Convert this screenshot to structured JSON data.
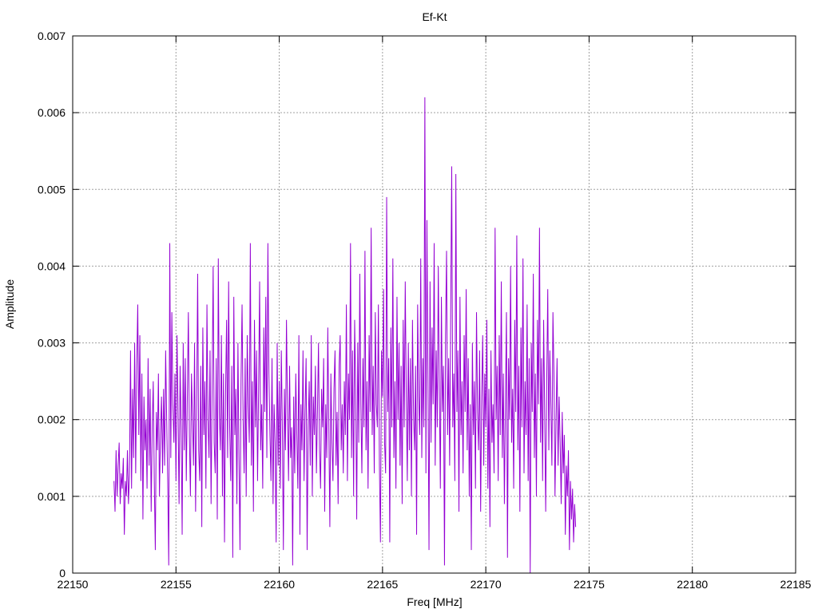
{
  "chart_data": {
    "type": "line",
    "title": "Ef-Kt",
    "xlabel": "Freq [MHz]",
    "ylabel": "Amplitude",
    "xlim": [
      22150,
      22185
    ],
    "ylim": [
      0,
      0.007
    ],
    "xticks": [
      22150,
      22155,
      22160,
      22165,
      22170,
      22175,
      22180,
      22185
    ],
    "xtick_labels": [
      "22150",
      "22155",
      "22160",
      "22165",
      "22170",
      "22175",
      "22180",
      "22185"
    ],
    "yticks": [
      0,
      0.001,
      0.002,
      0.003,
      0.004,
      0.005,
      0.006,
      0.007
    ],
    "ytick_labels": [
      "0",
      "0.001",
      "0.002",
      "0.003",
      "0.004",
      "0.005",
      "0.006",
      "0.007"
    ],
    "grid": true,
    "legend": "none",
    "series": [
      {
        "color": "#9400d3",
        "x_start": 22152.0,
        "x_step": 0.05,
        "values": [
          0.0012,
          0.0008,
          0.0016,
          0.001,
          0.0014,
          0.0017,
          0.0009,
          0.0013,
          0.0011,
          0.0015,
          0.0005,
          0.0012,
          0.001,
          0.0016,
          0.0009,
          0.0013,
          0.0029,
          0.0011,
          0.0024,
          0.0015,
          0.003,
          0.0013,
          0.0027,
          0.0035,
          0.0018,
          0.0031,
          0.0012,
          0.0026,
          0.0007,
          0.0023,
          0.0016,
          0.002,
          0.0011,
          0.0028,
          0.0014,
          0.0024,
          0.0008,
          0.0019,
          0.0025,
          0.0012,
          0.0003,
          0.0021,
          0.0016,
          0.0026,
          0.001,
          0.0018,
          0.0023,
          0.0013,
          0.0024,
          0.0014,
          0.0029,
          0.002,
          0.0012,
          0.0001,
          0.0043,
          0.0015,
          0.0034,
          0.0022,
          0.0017,
          0.0026,
          0.0012,
          0.0031,
          0.0021,
          0.0009,
          0.0027,
          0.0019,
          0.0005,
          0.003,
          0.0016,
          0.0028,
          0.0012,
          0.0023,
          0.0034,
          0.0018,
          0.001,
          0.0026,
          0.002,
          0.0014,
          0.003,
          0.0008,
          0.0021,
          0.0039,
          0.0016,
          0.0012,
          0.0027,
          0.0006,
          0.0032,
          0.0018,
          0.0025,
          0.0011,
          0.0035,
          0.002,
          0.0015,
          0.0029,
          0.0009,
          0.0024,
          0.004,
          0.0017,
          0.0013,
          0.0028,
          0.0007,
          0.0041,
          0.0021,
          0.0016,
          0.0031,
          0.001,
          0.0026,
          0.0004,
          0.0023,
          0.0033,
          0.0015,
          0.0038,
          0.0019,
          0.0012,
          0.0027,
          0.0002,
          0.0036,
          0.0018,
          0.0024,
          0.0009,
          0.003,
          0.0015,
          0.0003,
          0.0025,
          0.0035,
          0.002,
          0.0013,
          0.0028,
          0.001,
          0.0031,
          0.0022,
          0.0017,
          0.0043,
          0.0014,
          0.0025,
          0.0008,
          0.0033,
          0.0019,
          0.0029,
          0.0012,
          0.0024,
          0.0038,
          0.0016,
          0.0022,
          0.0011,
          0.0032,
          0.0021,
          0.0036,
          0.0015,
          0.0043,
          0.0026,
          0.0018,
          0.0012,
          0.0028,
          0.0009,
          0.0022,
          0.0017,
          0.0004,
          0.003,
          0.0014,
          0.0025,
          0.0011,
          0.0029,
          0.0019,
          0.0003,
          0.0024,
          0.0016,
          0.0033,
          0.0021,
          0.0012,
          0.0027,
          0.0015,
          0.0019,
          0.0001,
          0.0023,
          0.0013,
          0.0026,
          0.0018,
          0.0011,
          0.0031,
          0.0005,
          0.0022,
          0.0016,
          0.0029,
          0.0012,
          0.0021,
          0.0028,
          0.0003,
          0.0019,
          0.0025,
          0.0014,
          0.0031,
          0.001,
          0.0023,
          0.0018,
          0.0027,
          0.0013,
          0.0021,
          0.003,
          0.0016,
          0.0011,
          0.0024,
          0.0019,
          0.0028,
          0.0008,
          0.0022,
          0.0015,
          0.0032,
          0.0019,
          0.0006,
          0.0026,
          0.0017,
          0.0012,
          0.0024,
          0.0029,
          0.0014,
          0.0021,
          0.0009,
          0.0027,
          0.0031,
          0.0016,
          0.0022,
          0.0013,
          0.0025,
          0.0018,
          0.0035,
          0.0012,
          0.0026,
          0.002,
          0.0043,
          0.0015,
          0.0029,
          0.001,
          0.0033,
          0.0024,
          0.0007,
          0.003,
          0.0017,
          0.0039,
          0.0022,
          0.0013,
          0.0028,
          0.0019,
          0.0042,
          0.0016,
          0.0025,
          0.0011,
          0.0031,
          0.0021,
          0.0045,
          0.0018,
          0.0027,
          0.0013,
          0.0034,
          0.0022,
          0.0019,
          0.0035,
          0.0014,
          0.0004,
          0.0029,
          0.0023,
          0.0037,
          0.0017,
          0.0013,
          0.0049,
          0.0021,
          0.0028,
          0.0004,
          0.0032,
          0.0019,
          0.0041,
          0.0015,
          0.0025,
          0.0011,
          0.0036,
          0.002,
          0.003,
          0.0014,
          0.0027,
          0.0009,
          0.0033,
          0.0019,
          0.0038,
          0.0023,
          0.0012,
          0.003,
          0.0016,
          0.0028,
          0.001,
          0.0033,
          0.0021,
          0.0016,
          0.0027,
          0.0005,
          0.0035,
          0.0023,
          0.0018,
          0.0041,
          0.0015,
          0.0028,
          0.0019,
          0.0062,
          0.0013,
          0.0046,
          0.0025,
          0.0003,
          0.0038,
          0.0017,
          0.0032,
          0.0022,
          0.0043,
          0.0014,
          0.0029,
          0.0019,
          0.004,
          0.0024,
          0.0011,
          0.0036,
          0.0021,
          0.0027,
          0.0001,
          0.0031,
          0.0042,
          0.0018,
          0.0028,
          0.0014,
          0.0034,
          0.0053,
          0.0019,
          0.0026,
          0.0012,
          0.0052,
          0.0021,
          0.0029,
          0.0008,
          0.0036,
          0.0018,
          0.0025,
          0.0013,
          0.0031,
          0.0021,
          0.0037,
          0.0016,
          0.0028,
          0.001,
          0.0022,
          0.0003,
          0.003,
          0.0018,
          0.0025,
          0.0011,
          0.0034,
          0.0021,
          0.0016,
          0.0029,
          0.0008,
          0.0023,
          0.0031,
          0.0014,
          0.0026,
          0.0019,
          0.0033,
          0.0011,
          0.0024,
          0.0006,
          0.0029,
          0.0017,
          0.0022,
          0.0013,
          0.0045,
          0.002,
          0.0027,
          0.0012,
          0.0031,
          0.0018,
          0.0038,
          0.0015,
          0.0026,
          0.0009,
          0.0022,
          0.0034,
          0.0002,
          0.0028,
          0.002,
          0.004,
          0.0017,
          0.0024,
          0.0011,
          0.0033,
          0.0021,
          0.0044,
          0.0016,
          0.0027,
          0.0008,
          0.0032,
          0.0019,
          0.0041,
          0.0013,
          0.0025,
          0.0018,
          0.0035,
          0.0012,
          0.0028,
          0.0,
          0.003,
          0.0021,
          0.0039,
          0.0015,
          0.0026,
          0.001,
          0.0033,
          0.0022,
          0.0045,
          0.0017,
          0.0028,
          0.0012,
          0.0033,
          0.0021,
          0.0008,
          0.0025,
          0.0037,
          0.0016,
          0.0029,
          0.0022,
          0.0014,
          0.0034,
          0.0026,
          0.001,
          0.002,
          0.0028,
          0.0014,
          0.0023,
          0.0017,
          0.0009,
          0.0021,
          0.0013,
          0.0018,
          0.0005,
          0.0014,
          0.001,
          0.0016,
          0.0003,
          0.0012,
          0.0007,
          0.0011,
          0.0004,
          0.0009,
          0.0006
        ]
      }
    ]
  }
}
